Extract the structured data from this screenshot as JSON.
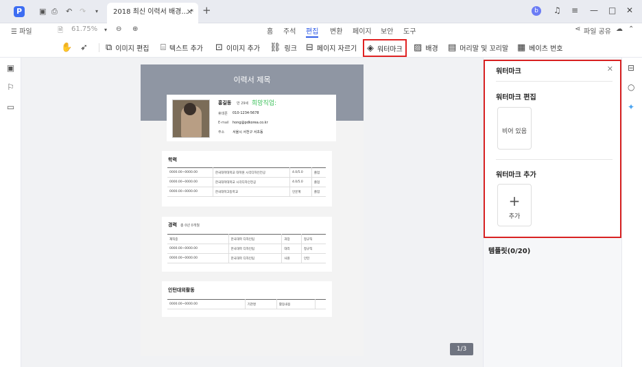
{
  "titlebar": {
    "logo": "P",
    "tab_title": "2018 최신 이력서 배경... *",
    "tab_close": "✕",
    "new_tab": "+",
    "avatar": "b"
  },
  "menu": {
    "file": "☰ 파일",
    "zoom": "61.75%",
    "ribbon_tabs": [
      "홈",
      "주석",
      "편집",
      "변환",
      "페이지",
      "보안",
      "도구"
    ],
    "active_tab": "편집",
    "share": "파일 공유"
  },
  "toolbar": {
    "edit_image": "이미지 편집",
    "add_text": "텍스트 추가",
    "add_image": "이미지 추가",
    "link": "링크",
    "crop_page": "페이지 자르기",
    "watermark": "워터마크",
    "background": "배경",
    "header_footer": "머리말 및 꼬리말",
    "bates": "베이츠 번호"
  },
  "document": {
    "resume_title": "이력서 제목",
    "name": "홍길동",
    "age": "만 29세",
    "desired_job": "희망직업:",
    "phone_label": "휴대폰",
    "phone": "010-1234-5678",
    "email_label": "E-mail",
    "email": "hong@pdkorea.co.kr",
    "addr_label": "주소",
    "addr": "서울시 서천구 서초동",
    "edu_title": "학력",
    "edu_rows": [
      [
        "0000.00~0000.00",
        "한국대학대학교 대학원 시각디자인전공",
        "4.0/5.0",
        "졸업"
      ],
      [
        "0000.00~0000.00",
        "한국대학대학교 시각디자인전공",
        "4.0/5.0",
        "졸업"
      ],
      [
        "0000.00~0000.00",
        "한국대학고등학교",
        "인문계",
        "졸업"
      ]
    ],
    "career_title": "경력",
    "career_sub": "총 0년 0개월",
    "career_rows": [
      [
        "재직중",
        "한국대학 디자인팀",
        "과장",
        "정규직"
      ],
      [
        "0000.00~0000.00",
        "한국대학 디자인팀",
        "대리",
        "정규직"
      ],
      [
        "0000.00~0000.00",
        "한국대학 디자인팀",
        "사원",
        "인턴"
      ]
    ],
    "intern_title": "인턴대외활동",
    "intern_rows": [
      [
        "0000.00~0000.00",
        "기관명",
        "활동내용"
      ]
    ],
    "page_indicator": "1/3"
  },
  "watermark_panel": {
    "title": "워터마크",
    "edit_section": "워터마크 편집",
    "empty_label": "비어 있음",
    "add_section": "워터마크 추가",
    "add_label": "추가",
    "templates": "템플릿(0/20)"
  },
  "colors": {
    "accent": "#2f5be6",
    "highlight": "#d82020",
    "header_gray": "#8f96a3",
    "desired_job_green": "#3cc05a"
  }
}
